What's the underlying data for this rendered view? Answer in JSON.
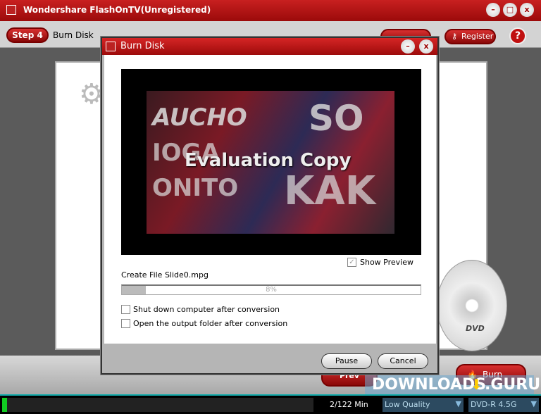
{
  "window": {
    "title": "Wondershare FlashOnTV(Unregistered)",
    "minimize": "–",
    "maximize": "□",
    "close": "x"
  },
  "toolbar": {
    "step_badge": "Step 4",
    "step_label": "Burn Disk",
    "register_label": "Register",
    "help": "?"
  },
  "dialog": {
    "title": "Burn Disk",
    "minimize": "–",
    "close": "x",
    "preview_watermark": "Evaluation Copy",
    "preview_banner_text": [
      "AUCHO",
      "IOGA",
      "ONITO",
      "SO",
      "KAK"
    ],
    "show_preview_label": "Show Preview",
    "show_preview_checked": true,
    "status_text": "Create File Slide0.mpg",
    "progress_percent": 8,
    "progress_label": "8%",
    "options": [
      {
        "label": "Shut down computer after conversion",
        "checked": false
      },
      {
        "label": "Open the output folder after conversion",
        "checked": false
      }
    ],
    "pause_label": "Pause",
    "cancel_label": "Cancel"
  },
  "bottom": {
    "prev_label": "Prev",
    "burn_label": "Burn"
  },
  "statusbar": {
    "duration": "2/122  Min",
    "quality": "Low Quality",
    "disc_type": "DVD-R 4.5G"
  },
  "watermark": {
    "text": "DOWNLOADS",
    ".guru": ".GURU"
  },
  "dvd_label": "DVD",
  "colors": {
    "accent": "#b01010",
    "status_bg": "#000000"
  }
}
